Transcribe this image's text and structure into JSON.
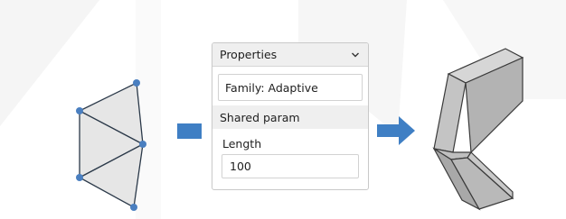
{
  "panel": {
    "title": "Properties",
    "family_label": "Family: Adaptive",
    "section_title": "Shared param",
    "param_label": "Length",
    "param_value": "100"
  },
  "icons": {
    "collapse": "chevron-down-icon",
    "arrow": "arrow-right-icon"
  },
  "colors": {
    "accent": "#3f7fc4",
    "node": "#4a7fc0",
    "panel_header": "#efefef",
    "solid_top": "#c9c9c9",
    "solid_side": "#a6a6a6"
  }
}
